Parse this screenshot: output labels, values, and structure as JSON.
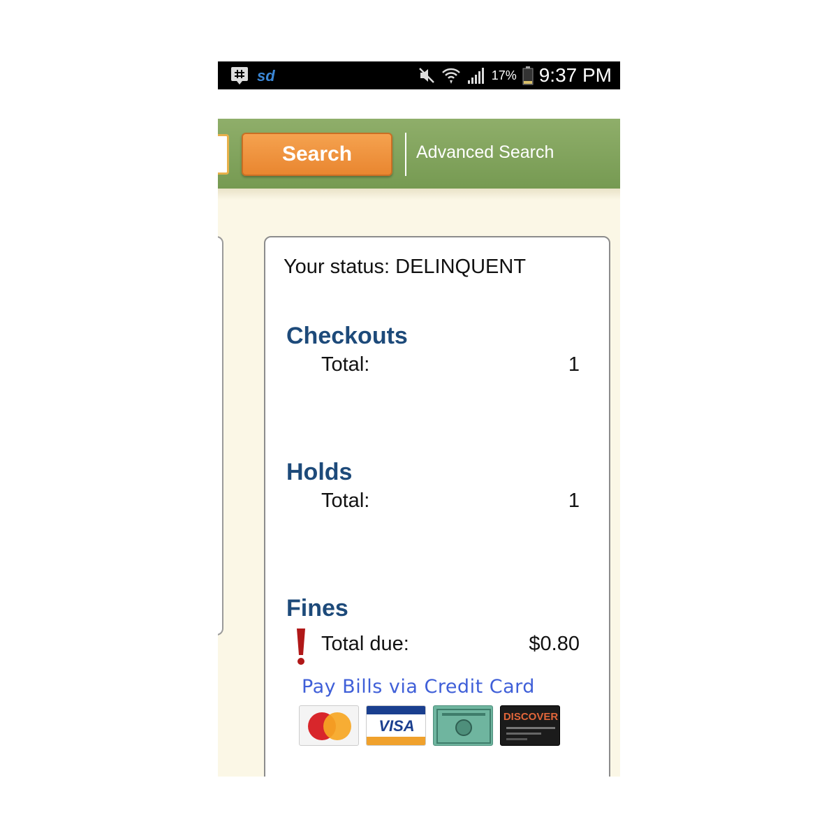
{
  "status_bar": {
    "time": "9:37 PM",
    "battery": "17%",
    "left_icons": [
      "messenger-icon",
      "sd-app-icon"
    ],
    "right_icons": [
      "mute-icon",
      "wifi-icon",
      "signal-icon",
      "battery-icon"
    ]
  },
  "header": {
    "search_label": "Search",
    "advanced_search_label": "Advanced Search",
    "accent_green": "#7fa25a",
    "accent_orange": "#ee8f38"
  },
  "account": {
    "status_text": "Your status: DELINQUENT",
    "checkouts": {
      "title": "Checkouts",
      "label": "Total:",
      "value": "1"
    },
    "holds": {
      "title": "Holds",
      "label": "Total:",
      "value": "1"
    },
    "fines": {
      "title": "Fines",
      "label": "Total due:",
      "value": "$0.80",
      "icon": "exclamation-icon"
    },
    "pay_link": "Pay Bills via Credit Card",
    "card_logos": [
      "mastercard-logo",
      "visa-logo",
      "amex-logo",
      "discover-logo"
    ],
    "visa_text": "VISA",
    "discover_text": "DISCOVER"
  }
}
